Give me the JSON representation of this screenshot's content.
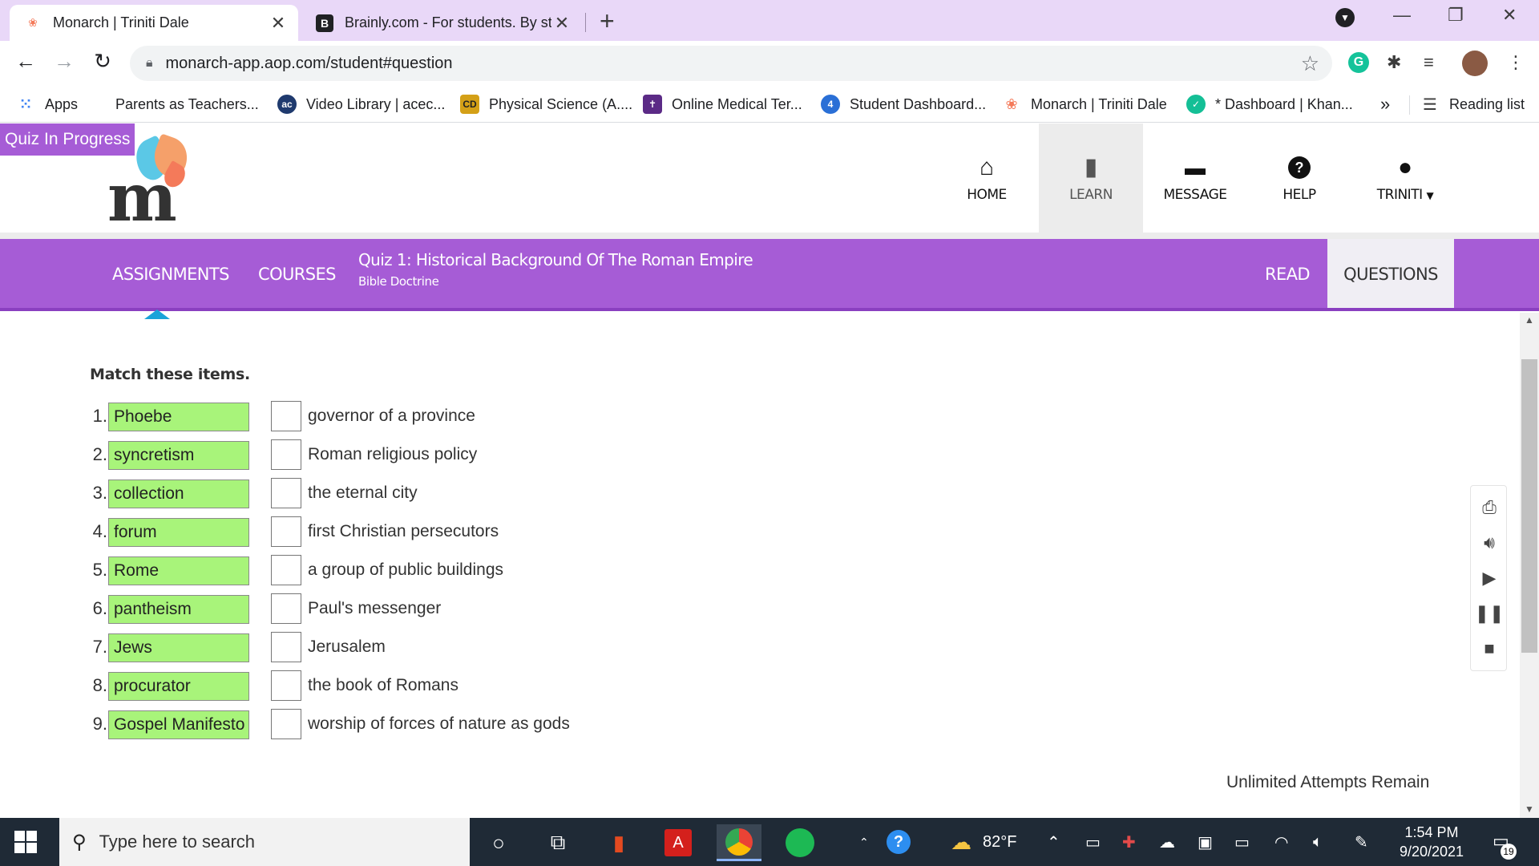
{
  "browser": {
    "tabs": [
      {
        "title": "Monarch | Triniti Dale",
        "active": true
      },
      {
        "title": "Brainly.com - For students. By stu",
        "active": false
      }
    ],
    "url": "monarch-app.aop.com/student#question",
    "bookmarks": [
      "Apps",
      "Parents as Teachers...",
      "Video Library | acec...",
      "Physical Science (A....",
      "Online Medical Ter...",
      "Student Dashboard...",
      "Monarch | Triniti Dale",
      "* Dashboard | Khan...",
      "Reading list"
    ]
  },
  "app": {
    "badge": "Quiz In Progress",
    "nav": [
      {
        "label": "HOME",
        "icon": "home-icon"
      },
      {
        "label": "LEARN",
        "icon": "book-icon"
      },
      {
        "label": "MESSAGE",
        "icon": "chat-icon"
      },
      {
        "label": "HELP",
        "icon": "help-icon"
      },
      {
        "label": "TRINITI",
        "icon": "user-icon"
      }
    ],
    "subnav": {
      "assignments": "ASSIGNMENTS",
      "courses": "COURSES",
      "quiz_title": "Quiz 1: Historical Background Of The Roman Empire",
      "quiz_subtitle": "Bible Doctrine",
      "read": "READ",
      "questions": "QUESTIONS"
    }
  },
  "question": {
    "instruction": "Match these items.",
    "items": [
      {
        "num": "1.",
        "term": "Phoebe",
        "definition": "governor of a province",
        "answer": ""
      },
      {
        "num": "2.",
        "term": "syncretism",
        "definition": "Roman religious policy",
        "answer": ""
      },
      {
        "num": "3.",
        "term": "collection",
        "definition": "the eternal city",
        "answer": ""
      },
      {
        "num": "4.",
        "term": "forum",
        "definition": "first Christian persecutors",
        "answer": ""
      },
      {
        "num": "5.",
        "term": "Rome",
        "definition": "a group of public buildings",
        "answer": ""
      },
      {
        "num": "6.",
        "term": "pantheism",
        "definition": "Paul's messenger",
        "answer": ""
      },
      {
        "num": "7.",
        "term": "Jews",
        "definition": "Jerusalem",
        "answer": ""
      },
      {
        "num": "8.",
        "term": "procurator",
        "definition": "the book of Romans",
        "answer": ""
      },
      {
        "num": "9.",
        "term": "Gospel Manifesto",
        "definition": "worship of forces of nature as gods",
        "answer": ""
      }
    ],
    "attempts": "Unlimited Attempts Remain",
    "term_color": "#a8f47a"
  },
  "taskbar": {
    "search_placeholder": "Type here to search",
    "weather": "82°F",
    "time": "1:54 PM",
    "date": "9/20/2021",
    "notifications": "19"
  },
  "colors": {
    "brand_purple": "#a65cd6",
    "tabstrip": "#e9d8f8"
  }
}
